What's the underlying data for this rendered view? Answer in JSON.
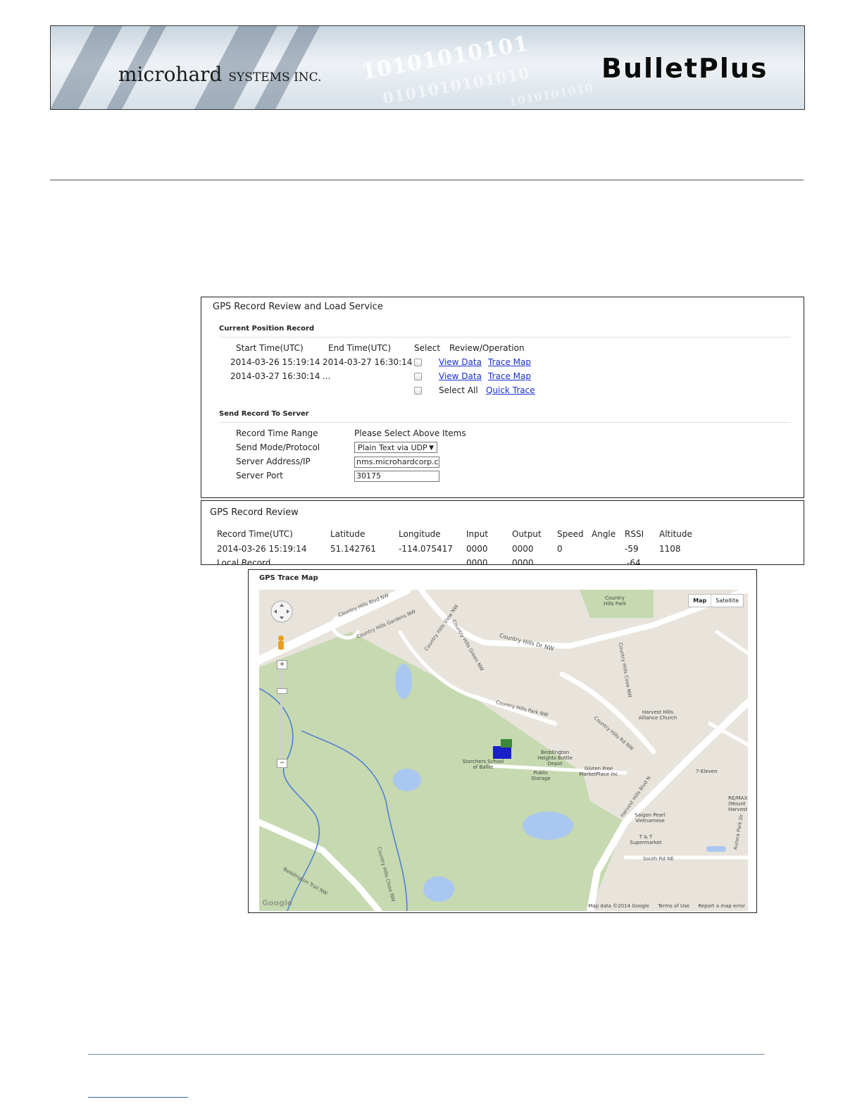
{
  "header": {
    "company": "microhard",
    "company_suffix": "SYSTEMS INC.",
    "product": "BulletPlus",
    "binary_rows": [
      "10101010101",
      "0101010101010",
      "1010101010"
    ]
  },
  "load_service": {
    "title": "GPS Record Review and Load Service",
    "current_section": "Current Position Record",
    "columns": [
      "Start Time(UTC)",
      "End Time(UTC)",
      "Select",
      "Review/Operation"
    ],
    "rows": [
      {
        "start": "2014-03-26 15:19:14",
        "end": "2014-03-27 16:30:14",
        "view": "View Data",
        "trace": "Trace Map"
      },
      {
        "start": "2014-03-27 16:30:14",
        "end": "...",
        "view": "View Data",
        "trace": "Trace Map"
      }
    ],
    "select_all": "Select All",
    "quick_trace": "Quick Trace",
    "send_section": "Send Record To Server",
    "fields": {
      "time_range_label": "Record Time Range",
      "time_range_value": "Please Select Above Items",
      "mode_label": "Send Mode/Protocol",
      "mode_value": "Plain Text via UDP",
      "server_label": "Server Address/IP",
      "server_value": "nms.microhardcorp.com",
      "port_label": "Server Port",
      "port_value": "30175"
    }
  },
  "record_review": {
    "title": "GPS Record Review",
    "columns": [
      "Record Time(UTC)",
      "Latitude",
      "Longitude",
      "Input",
      "Output",
      "Speed",
      "Angle",
      "RSSI",
      "Altitude"
    ],
    "rows": [
      [
        "2014-03-26 15:19:14",
        "51.142761",
        "-114.075417",
        "0000",
        "0000",
        "0",
        "",
        "-59",
        "1108"
      ],
      [
        "Local Record",
        "",
        "",
        "0000",
        "0000",
        "",
        "",
        "-64",
        ""
      ]
    ]
  },
  "trace_map": {
    "title": "GPS Trace Map",
    "map_types": [
      "Map",
      "Satellite"
    ],
    "roads": [
      "Country Hills Blvd NW",
      "Country Hills Gardens NW",
      "Country Hills View NW",
      "Country Hills Green NW",
      "Country Hills Dr NW",
      "Country Hills Park NW",
      "Country Hills Rd NW",
      "Harvest Hills Blvd N",
      "Beddington Trail NW",
      "Country Hills Close NW",
      "South Rd NE",
      "Aurora Park Dr",
      "Country Hills Cove NW"
    ],
    "places": [
      "Country Hills Park",
      "Harvest Hills Alliance Church",
      "Beddington Heights Bottle Depot",
      "Starchers School of Ballet",
      "Public Storage",
      "Gluten Free MarketPlace Inc",
      "7-Eleven",
      "Saigon Pearl Vietnamese",
      "T & T Supermarket",
      "RE/MAX (Mount Harvest"
    ],
    "footer": [
      "Map data ©2014 Google",
      "Terms of Use",
      "Report a map error"
    ],
    "logo": "Google"
  }
}
